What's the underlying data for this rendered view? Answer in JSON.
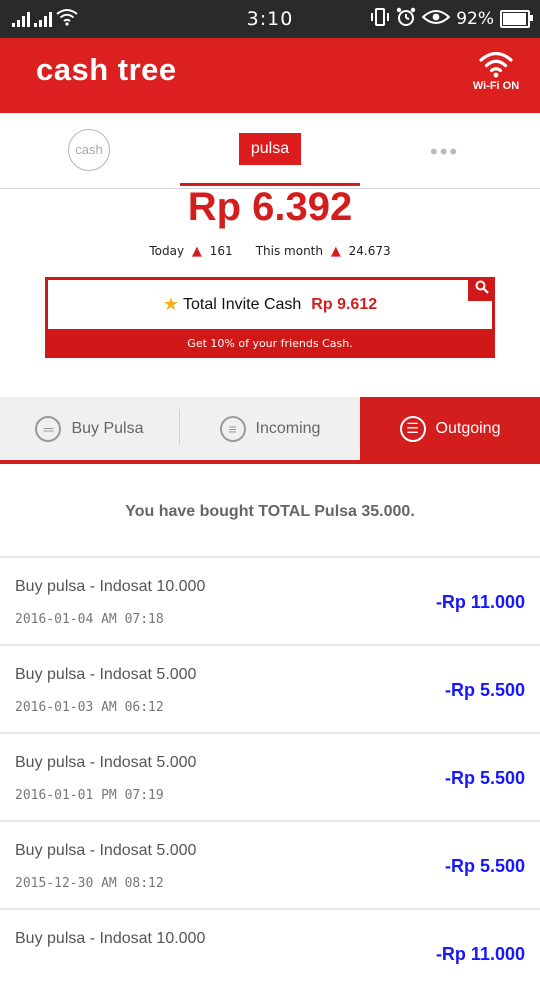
{
  "status_bar": {
    "time": "3:10",
    "battery": "92%"
  },
  "app": {
    "title": "cash tree",
    "wifi_label": "Wi-Fi ON"
  },
  "tabs": {
    "cash": "cash",
    "pulsa": "pulsa",
    "more": "•••"
  },
  "balance": {
    "amount": "Rp 6.392",
    "today_label": "Today",
    "today_value": "161",
    "month_label": "This month",
    "month_value": "24.673"
  },
  "invite": {
    "label": "Total Invite Cash",
    "amount": "Rp 9.612",
    "subtitle": "Get 10% of your friends Cash."
  },
  "segments": [
    {
      "label": "Buy Pulsa",
      "active": false
    },
    {
      "label": "Incoming",
      "active": false
    },
    {
      "label": "Outgoing",
      "active": true
    }
  ],
  "summary": "You have bought TOTAL Pulsa 35.000.",
  "transactions": [
    {
      "title": "Buy pulsa - Indosat 10.000",
      "time": "2016-01-04 AM 07:18",
      "amount": "-Rp 11.000"
    },
    {
      "title": "Buy pulsa - Indosat 5.000",
      "time": "2016-01-03 AM 06:12",
      "amount": "-Rp 5.500"
    },
    {
      "title": "Buy pulsa - Indosat 5.000",
      "time": "2016-01-01 PM 07:19",
      "amount": "-Rp 5.500"
    },
    {
      "title": "Buy pulsa - Indosat 5.000",
      "time": "2015-12-30 AM 08:12",
      "amount": "-Rp 5.500"
    },
    {
      "title": "Buy pulsa - Indosat 10.000",
      "time": "",
      "amount": "-Rp 11.000"
    }
  ],
  "colors": {
    "brand_red": "#dc1f1f",
    "amount_blue": "#1717ff"
  }
}
